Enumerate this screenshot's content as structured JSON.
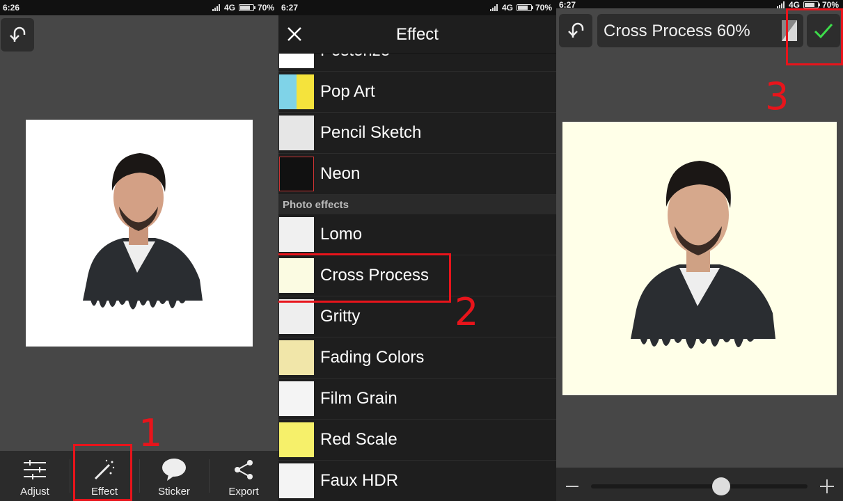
{
  "panel1": {
    "status": {
      "time": "6:26",
      "network": "4G",
      "battery": "70%",
      "battery_level": 0.7
    },
    "toolbar": {
      "adjust_label": "Adjust",
      "effect_label": "Effect",
      "sticker_label": "Sticker",
      "export_label": "Export"
    },
    "step_number": "1"
  },
  "panel2": {
    "status": {
      "time": "6:27",
      "network": "4G",
      "battery": "70%",
      "battery_level": 0.7
    },
    "title": "Effect",
    "partial_item": "Posterize",
    "items_top": [
      "Pop Art",
      "Pencil Sketch",
      "Neon"
    ],
    "section_label": "Photo effects",
    "items_photo": [
      "Lomo",
      "Cross Process",
      "Gritty",
      "Fading Colors",
      "Film Grain",
      "Red Scale",
      "Faux HDR"
    ],
    "step_number": "2"
  },
  "panel3": {
    "status": {
      "time": "6:27",
      "network": "4G",
      "battery": "70%",
      "battery_level": 0.7
    },
    "effect_strength_label": "Cross Process 60%",
    "slider_value": 0.6,
    "step_number": "3"
  },
  "colors": {
    "annotation_red": "#e8141b",
    "check_green": "#3ddc4a"
  }
}
